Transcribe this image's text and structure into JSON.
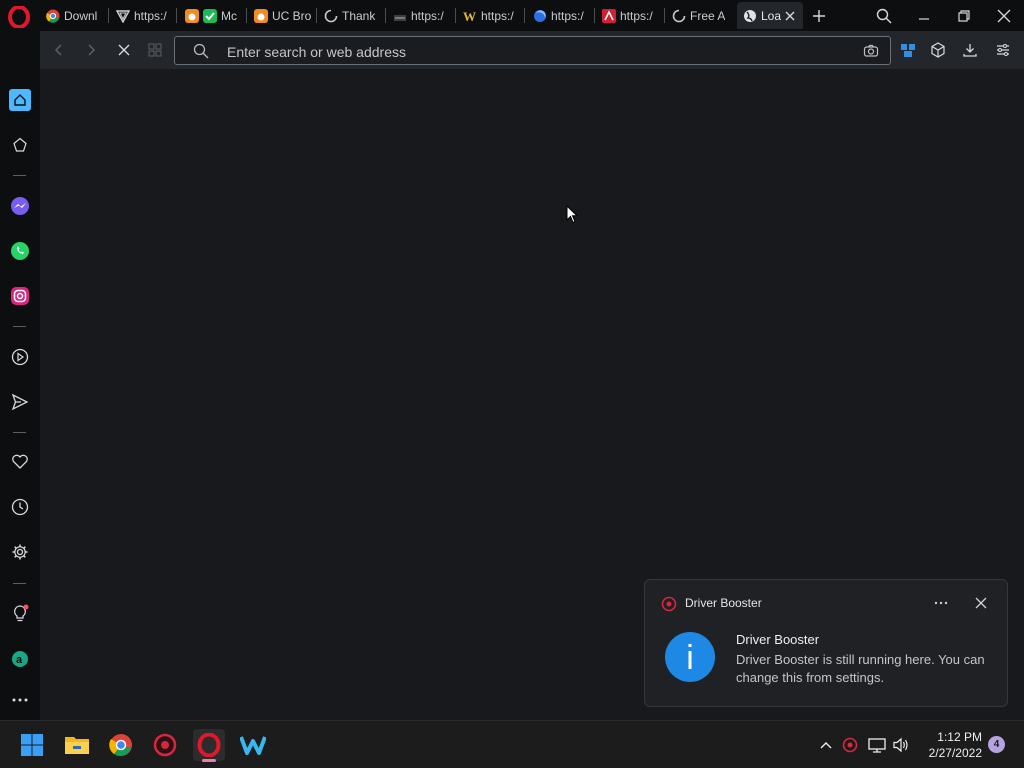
{
  "browser": {
    "tabs": [
      {
        "label": "Downl",
        "icon": "chrome-favicon"
      },
      {
        "label": "https:/",
        "icon": "vpn-shield-favicon"
      },
      {
        "label": "Mc",
        "icon": "uc-browser-favicon"
      },
      {
        "label": "UC Bro",
        "icon": "uc-browser-favicon"
      },
      {
        "label": "Thank",
        "icon": "loading-spinner-icon"
      },
      {
        "label": "https:/",
        "icon": "site-favicon"
      },
      {
        "label": "https:/",
        "icon": "w-favicon"
      },
      {
        "label": "https:/",
        "icon": "firefox-favicon"
      },
      {
        "label": "https:/",
        "icon": "red-favicon"
      },
      {
        "label": "Free A",
        "icon": "loading-spinner-icon"
      },
      {
        "label": "Loa",
        "icon": "globe-favicon",
        "active": true
      }
    ],
    "address_placeholder": "Enter search or web address",
    "accent": "#4db8ff"
  },
  "toast": {
    "app_name": "Driver Booster",
    "title": "Driver Booster",
    "body": "Driver Booster is still running here. You can change this from settings.",
    "accent": "#d9263d",
    "info_color": "#1e88e5"
  },
  "taskbar": {
    "time": "1:12 PM",
    "date": "2/27/2022",
    "notification_count": "4"
  }
}
